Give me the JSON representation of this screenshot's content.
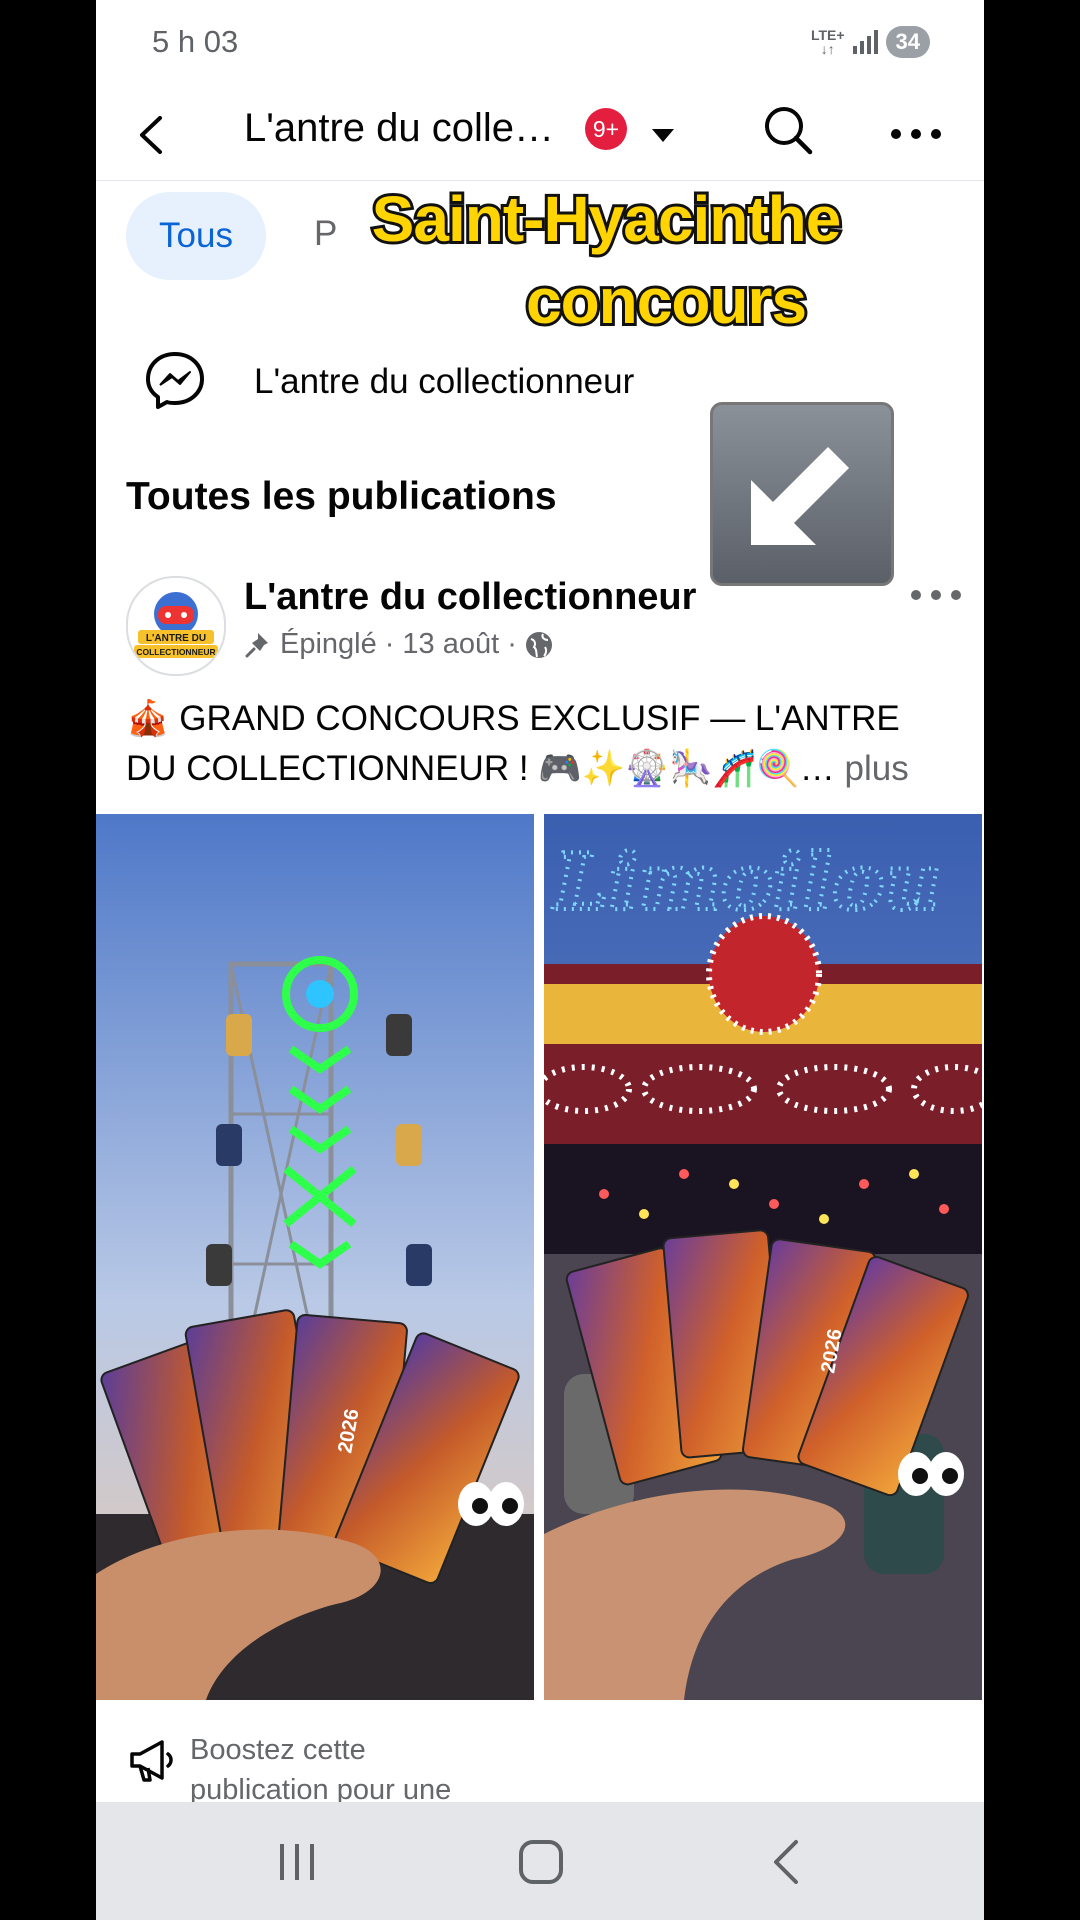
{
  "status_bar": {
    "time": "5 h 03",
    "network": "LTE+",
    "battery": "34"
  },
  "header": {
    "title": "L'antre du colle…",
    "badge": "9+"
  },
  "filters": {
    "tous": "Tous",
    "partial": "P"
  },
  "overlay": {
    "line1": "Saint-Hyacinthe",
    "line2": "concours"
  },
  "messenger": {
    "label": "L'antre du collectionneur"
  },
  "section": {
    "title": "Toutes les publications"
  },
  "post": {
    "author": "L'antre du collectionneur",
    "avatar_text_1": "L'ANTRE DU",
    "avatar_text_2": "COLLECTIONNEUR",
    "pinned": "Épinglé",
    "separator": "·",
    "date": "13 août",
    "text_line1": "🎪 GRAND CONCOURS EXCLUSIF — L'ANTRE",
    "text_line2": "DU COLLECTIONNEUR ! 🎮✨🎡🎠🎢🍭…",
    "more_label": "plus",
    "ticket_year": "2026",
    "sign_text": "Limoilou"
  },
  "boost": {
    "line1": "Boostez cette",
    "line2": "publication pour une"
  },
  "colors": {
    "accent": "#0a64d6",
    "chip_bg": "#e7f0fd",
    "badge": "#e41e3f",
    "overlay_text": "#ffd400"
  },
  "icons": [
    "back-arrow-icon",
    "caret-down-icon",
    "search-icon",
    "more-icon",
    "messenger-icon",
    "arrow-down-left-icon",
    "pin-icon",
    "globe-icon",
    "megaphone-icon",
    "recent-apps-icon",
    "home-icon",
    "nav-back-icon"
  ]
}
